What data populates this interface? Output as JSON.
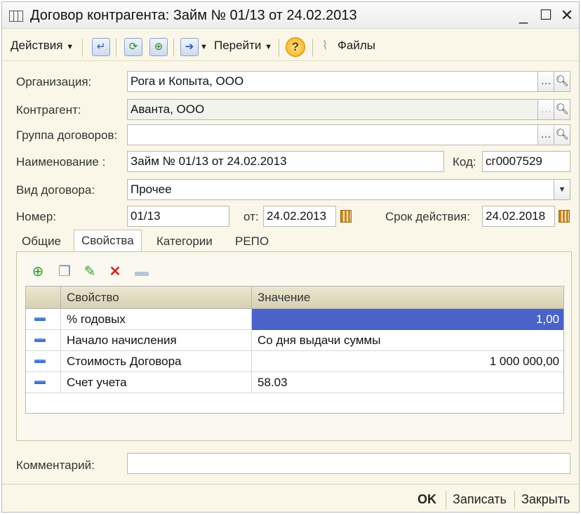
{
  "window": {
    "title": "Договор контрагента: Займ № 01/13 от 24.02.2013"
  },
  "toolbar": {
    "actions_label": "Действия",
    "goto_label": "Перейти",
    "files_label": "Файлы"
  },
  "form": {
    "organization": {
      "label": "Организация:",
      "value": "Рога и Копыта, ООО"
    },
    "counterparty": {
      "label": "Контрагент:",
      "value": "Аванта, ООО"
    },
    "contract_group": {
      "label": "Группа договоров:",
      "value": ""
    },
    "name": {
      "label": "Наименование :",
      "value": "Займ № 01/13 от 24.02.2013"
    },
    "code": {
      "label": "Код:",
      "value": "сг0007529"
    },
    "contract_type": {
      "label": "Вид договора:",
      "value": "Прочее"
    },
    "number": {
      "label": "Номер:",
      "value": "01/13"
    },
    "date": {
      "label": "от:",
      "value": "24.02.2013"
    },
    "validity": {
      "label": "Срок действия:",
      "value": "24.02.2018"
    },
    "comment": {
      "label": "Комментарий:",
      "value": ""
    }
  },
  "tabs": [
    "Общие",
    "Свойства",
    "Категории",
    "РЕПО"
  ],
  "active_tab": "Свойства",
  "properties": {
    "columns": [
      "Свойство",
      "Значение"
    ],
    "rows": [
      {
        "property": "% годовых",
        "value": "1,00"
      },
      {
        "property": "Начало начисления",
        "value": "Со дня выдачи суммы"
      },
      {
        "property": "Стоимость Договора",
        "value": "1 000 000,00"
      },
      {
        "property": "Счет учета",
        "value": "58.03"
      }
    ]
  },
  "footer": {
    "ok_label": "OK",
    "save_label": "Записать",
    "close_label": "Закрыть"
  },
  "colors": {
    "selection": "#4a63c8",
    "background": "#faf7e8"
  }
}
